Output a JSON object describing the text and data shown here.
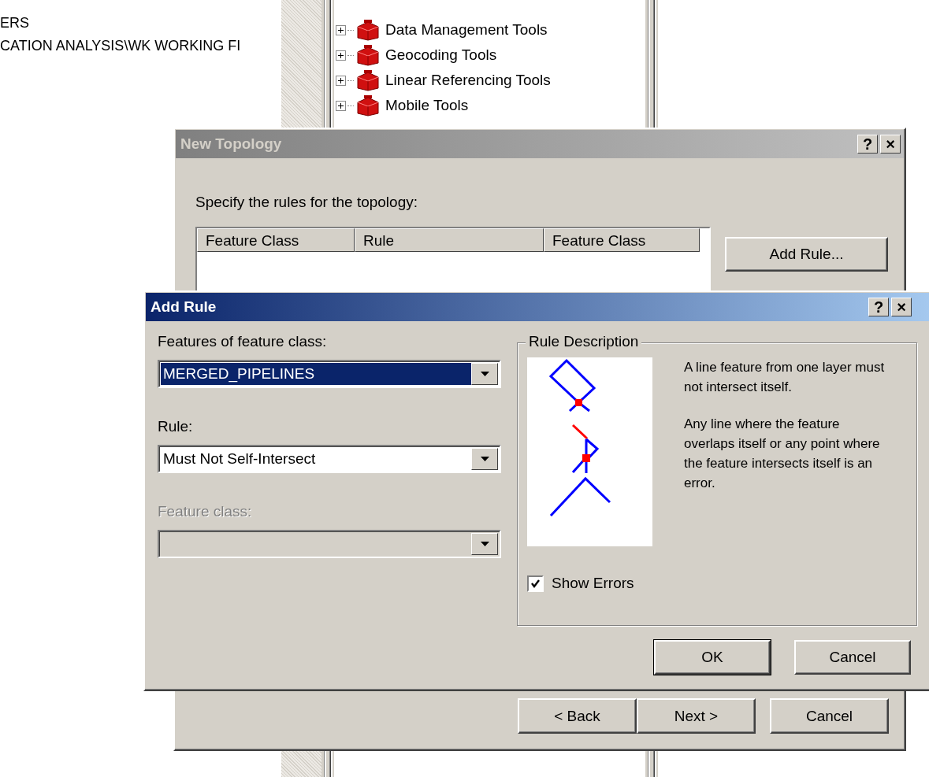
{
  "background_texts": [
    "ERS",
    "CATION ANALYSIS\\WK WORKING FI"
  ],
  "toolbox_tree": {
    "items": [
      {
        "label": "Data Management Tools",
        "expanded": false
      },
      {
        "label": "Geocoding Tools",
        "expanded": false
      },
      {
        "label": "Linear Referencing Tools",
        "expanded": false
      },
      {
        "label": "Mobile Tools",
        "expanded": false
      }
    ]
  },
  "new_topology": {
    "title": "New Topology",
    "active": false,
    "title_buttons": [
      "?",
      "×"
    ],
    "instruction": "Specify the rules for the topology:",
    "rules_table": {
      "columns": [
        "Feature Class",
        "Rule",
        "Feature Class"
      ]
    },
    "add_rule_button": "Add Rule...",
    "buttons": [
      {
        "label": "< Back",
        "kind": "wizard"
      },
      {
        "label": "Next >",
        "kind": "wizard"
      },
      {
        "label": "Cancel",
        "kind": "separate"
      }
    ]
  },
  "add_rule": {
    "title": "Add Rule",
    "active": true,
    "title_buttons": [
      "?",
      "×"
    ],
    "fields": [
      {
        "label": "Features of feature class:",
        "value": "MERGED_PIPELINES",
        "highlighted": true,
        "disabled": false
      },
      {
        "label": "Rule:",
        "value": "Must Not Self-Intersect",
        "highlighted": false,
        "disabled": false
      },
      {
        "label": "Feature class:",
        "highlighted": false,
        "disabled": true
      }
    ],
    "rule_description": {
      "title": "Rule Description",
      "paragraphs": [
        "A line feature from one layer must not intersect itself.",
        "Any line where the feature overlaps itself or any point where the feature intersects itself is an error."
      ],
      "show_errors": {
        "label": "Show Errors",
        "checked": true
      }
    },
    "buttons": [
      {
        "label": "OK",
        "default": true
      },
      {
        "label": "Cancel",
        "default": false
      }
    ]
  }
}
